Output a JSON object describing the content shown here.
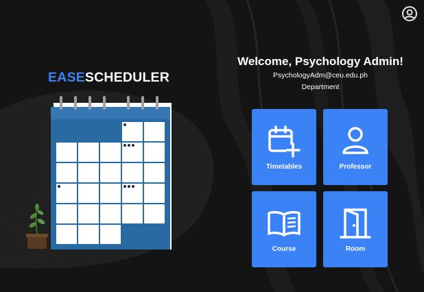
{
  "header": {
    "profile_icon": "user-circle-icon"
  },
  "logo": {
    "part1": "EASE",
    "part2": "SCHEDULER",
    "accent_color": "#3b82f6"
  },
  "welcome": {
    "title": "Welcome, Psychology Admin!",
    "email": "PsychologyAdm@ceu.edu.ph",
    "department": "Department"
  },
  "tiles": [
    {
      "label": "Timetables",
      "icon": "calendar-plus-icon"
    },
    {
      "label": "Professor",
      "icon": "user-icon"
    },
    {
      "label": "Course",
      "icon": "book-open-icon"
    },
    {
      "label": "Room",
      "icon": "door-icon"
    }
  ],
  "colors": {
    "background": "#151515",
    "tile": "#3b82f6",
    "calendar_blue": "#2a6aa3"
  }
}
